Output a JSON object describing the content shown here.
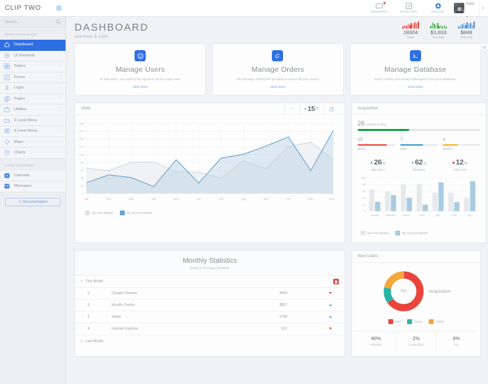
{
  "brand": {
    "name": "CLIP TWO"
  },
  "topnav": {
    "items": [
      {
        "label": "MESSAGES",
        "icon": "message-icon",
        "badge": true
      },
      {
        "label": "ACTIVITIES",
        "icon": "checklist-icon",
        "badge": false
      },
      {
        "label": "ENGLISH",
        "icon": "globe-icon",
        "badge": false
      }
    ],
    "user": {
      "name": "Peter",
      "caret": "▾"
    }
  },
  "sidebar": {
    "search_placeholder": "Search...",
    "nav_header": "MAIN NAVIGATION",
    "items": [
      {
        "label": "Dashboard",
        "icon": "home-icon",
        "active": true,
        "caret": ""
      },
      {
        "label": "UI Elements",
        "icon": "gear-icon",
        "active": false,
        "caret": "‹"
      },
      {
        "label": "Tables",
        "icon": "grid-icon",
        "active": false,
        "caret": "‹"
      },
      {
        "label": "Forms",
        "icon": "pencil-icon",
        "active": false,
        "caret": "‹"
      },
      {
        "label": "Login",
        "icon": "user-icon",
        "active": false,
        "caret": "‹"
      },
      {
        "label": "Pages",
        "icon": "copy-icon",
        "active": false,
        "caret": "‹"
      },
      {
        "label": "Utilities",
        "icon": "toolbox-icon",
        "active": false,
        "caret": "‹"
      },
      {
        "label": "3 Level Menu",
        "icon": "folder-icon",
        "active": false,
        "caret": "‹"
      },
      {
        "label": "4 Level Menu",
        "icon": "list-icon",
        "active": false,
        "caret": "‹"
      },
      {
        "label": "Maps",
        "icon": "pin-icon",
        "active": false,
        "caret": ""
      },
      {
        "label": "Charts",
        "icon": "clock-icon",
        "active": false,
        "caret": ""
      }
    ],
    "core_header": "CORE FEATURES",
    "core_items": [
      {
        "label": "Calendar",
        "icon": "calendar-icon"
      },
      {
        "label": "Messages",
        "icon": "mail-icon"
      }
    ],
    "doc_button": "Documentation"
  },
  "page": {
    "title": "DASHBOARD",
    "subtitle": "overview & stats"
  },
  "head_stats": [
    {
      "value": "18304",
      "label": "Sales",
      "color": "#e8453c",
      "bars": [
        30,
        45,
        38,
        60,
        50,
        72,
        58,
        85,
        70,
        95
      ]
    },
    {
      "value": "$3,833",
      "label": "Earnings",
      "color": "#4caf50",
      "bars": [
        40,
        85,
        60,
        45,
        70,
        35,
        50,
        30,
        42,
        28
      ]
    },
    {
      "value": "$848",
      "label": "Referrals",
      "color": "#4b8fd4",
      "bars": [
        25,
        40,
        55,
        70,
        45,
        85,
        60,
        75,
        50,
        90
      ]
    }
  ],
  "promos": [
    {
      "title": "Manage Users",
      "desc": "To add users, you need to be signed in as the super user.",
      "link": "view more",
      "icon": "smiley-icon"
    },
    {
      "title": "Manage Orders",
      "desc": "The Manage Orders tool provides a view of all your orders.",
      "link": "view more",
      "icon": "tag-icon"
    },
    {
      "title": "Manage Database",
      "desc": "Store, modify, and extract information from your database.",
      "link": "view more",
      "icon": "terminal-icon"
    }
  ],
  "visits": {
    "title": "Visits",
    "controls": {
      "dash": "—",
      "percent": "15",
      "percent_symbol": "%",
      "refresh": "refresh-icon"
    }
  },
  "acquisition": {
    "title": "Acquisition",
    "online": {
      "value": "26",
      "label": "visitors on-line",
      "percent": 42,
      "color": "#1aa64b"
    },
    "channels": [
      {
        "value": "15",
        "label": "Direct",
        "percent": 78,
        "color": "#e8453c"
      },
      {
        "value": "7",
        "label": "Sites",
        "percent": 62,
        "color": "#3b9ad4"
      },
      {
        "value": "4",
        "label": "Search",
        "percent": 40,
        "color": "#f5b325"
      }
    ],
    "os": [
      {
        "value": "26",
        "symbol": "%",
        "label": "Mac OS X",
        "color": "#4b8fd4"
      },
      {
        "value": "62",
        "symbol": "%",
        "label": "Windows",
        "color": "#4ba8c9"
      },
      {
        "value": "12",
        "symbol": "%",
        "label": "Other OS",
        "color": "#e8453c"
      }
    ]
  },
  "monthly": {
    "title": "Monthly Statistics",
    "subtitle": "based on the major browsers",
    "groups": [
      {
        "caret": "▾",
        "label": "This Month",
        "has_delete": true
      },
      {
        "caret": "▾",
        "label": "Last Month",
        "has_delete": false
      }
    ],
    "rows": [
      {
        "index": "1",
        "name": "Google Chrome",
        "value": "4909",
        "trend": "down"
      },
      {
        "index": "2",
        "name": "Mozilla Firefox",
        "value": "3857",
        "trend": "up"
      },
      {
        "index": "3",
        "name": "Safari",
        "value": "1789",
        "trend": "up"
      },
      {
        "index": "4",
        "name": "Internet Explorer",
        "value": "612",
        "trend": "down"
      }
    ]
  },
  "new_users": {
    "title": "New Users",
    "donut_center": "450",
    "donut_label": "Acquisition",
    "footer": [
      {
        "value": "90%",
        "label": "Satisfied"
      },
      {
        "value": "2%",
        "label": "Unsatisfied"
      },
      {
        "value": "8%",
        "label": "NA"
      }
    ]
  },
  "colors": {
    "accent": "#2f6fe4",
    "series_gray": "#d8dce0",
    "series_blue": "#6ca3cf",
    "red": "#e8453c",
    "green": "#29b5a8",
    "yellow": "#f5a73b"
  },
  "chart_data": [
    {
      "type": "area",
      "title": "Visits",
      "categories": [
        "Jan",
        "Feb",
        "Mar",
        "Apr",
        "May",
        "Jun",
        "Jul",
        "Aug",
        "Sep",
        "Oct",
        "Nov",
        "Dec"
      ],
      "series": [
        {
          "name": "My First dataset",
          "color": "#d8dce0",
          "values": [
            65,
            59,
            80,
            81,
            56,
            55,
            40,
            84,
            64,
            121,
            132,
            87
          ]
        },
        {
          "name": "My Second dataset",
          "color": "#6ca3cf",
          "values": [
            28,
            48,
            41,
            18,
            87,
            27,
            91,
            101,
            122,
            145,
            59,
            162
          ]
        }
      ],
      "ylim": [
        0,
        180
      ],
      "yticks": [
        20,
        40,
        60,
        80,
        100,
        120,
        140,
        160,
        180
      ],
      "xlabel": "",
      "ylabel": "",
      "grid": true,
      "legend": "bottom-left"
    },
    {
      "type": "bar",
      "title": "Acquisition",
      "categories": [
        "January",
        "February",
        "March",
        "April",
        "May",
        "June",
        "July"
      ],
      "series": [
        {
          "name": "My First dataset",
          "color": "#e4e7ea",
          "values": [
            65,
            59,
            80,
            81,
            56,
            55,
            40
          ]
        },
        {
          "name": "My Second dataset",
          "color": "#a8cbe2",
          "values": [
            28,
            48,
            40,
            19,
            86,
            27,
            90
          ]
        }
      ],
      "ylim": [
        0,
        100
      ],
      "yticks": [
        0,
        20,
        40,
        60,
        80,
        100
      ],
      "xlabel": "",
      "ylabel": "",
      "grid": true,
      "legend": "bottom-left"
    },
    {
      "type": "pie",
      "title": "New Users",
      "center_label": "450",
      "annotation": "Acquisition",
      "labels": [
        "Red",
        "Green",
        "Yellow"
      ],
      "values": [
        65,
        13,
        22
      ],
      "colors": [
        "#e8453c",
        "#29b5a8",
        "#f5a73b"
      ],
      "legend": "bottom"
    }
  ]
}
